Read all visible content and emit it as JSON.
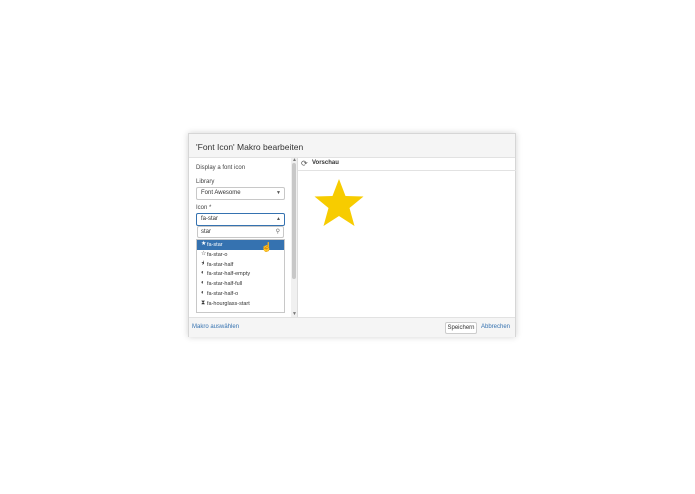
{
  "dialog": {
    "title": "'Font Icon' Makro bearbeiten"
  },
  "form": {
    "description": "Display a font icon",
    "library_label": "Library",
    "library_value": "Font Awesome",
    "icon_label": "Icon *",
    "icon_value": "fa-star",
    "search_value": "star",
    "results": [
      {
        "label": "fa-star",
        "icon": "star-icon",
        "selected": true
      },
      {
        "label": "fa-star-o",
        "icon": "star-outline-icon",
        "selected": false
      },
      {
        "label": "fa-star-half",
        "icon": "star-half-icon",
        "selected": false
      },
      {
        "label": "fa-star-half-empty",
        "icon": "star-half-empty-icon",
        "selected": false
      },
      {
        "label": "fa-star-half-full",
        "icon": "star-half-full-icon",
        "selected": false
      },
      {
        "label": "fa-star-half-o",
        "icon": "star-half-o-icon",
        "selected": false
      },
      {
        "label": "fa-hourglass-start",
        "icon": "hourglass-start-icon",
        "selected": false
      }
    ]
  },
  "preview": {
    "label": "Vorschau",
    "star_color": "#f7cc00"
  },
  "footer": {
    "select_macro_link": "Makro auswählen",
    "save_label": "Speichern",
    "cancel_label": "Abbrechen"
  },
  "colors": {
    "accent": "#3572b0",
    "header_bg": "#f5f5f5"
  }
}
